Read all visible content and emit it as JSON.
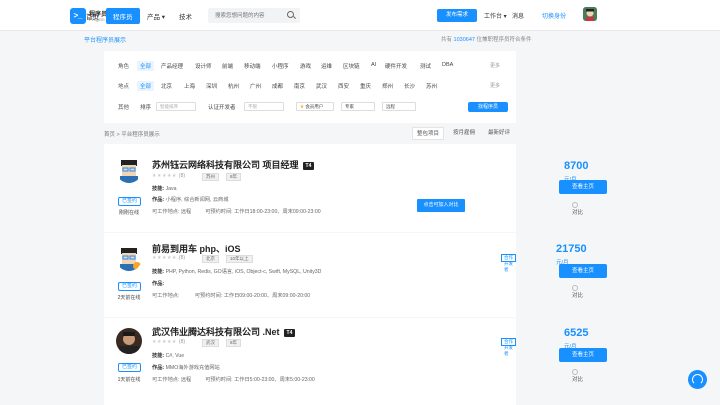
{
  "logo": {
    "name": "程序员客栈",
    "domain": "Proginn.com"
  },
  "nav": [
    "首页",
    "程序员",
    "产品",
    "技术"
  ],
  "search_placeholder": "搜索您想问题的内容",
  "header_right": {
    "post": "发布需求",
    "workspace": "工作台",
    "messages": "消息",
    "switch": "切换身份"
  },
  "sub": {
    "title": "平台程序员展示",
    "stats_prefix": "共有",
    "stats_count": "1030647",
    "stats_suffix": "位兼职程序员符合条件"
  },
  "filters": {
    "role_label": "角色",
    "roles": [
      "全部",
      "产品经理",
      "设计师",
      "前端",
      "移动端",
      "小程序",
      "游戏",
      "运维",
      "区块链",
      "AI",
      "硬件开发",
      "测试",
      "DBA"
    ],
    "location_label": "地点",
    "locations": [
      "全部",
      "北京",
      "上海",
      "深圳",
      "杭州",
      "广州",
      "成都",
      "南京",
      "武汉",
      "西安",
      "重庆",
      "郑州",
      "长沙",
      "苏州"
    ],
    "more": "更多",
    "other_label": "其他",
    "sort_label": "排序",
    "sort_value": "智能排序",
    "cert_label": "认证开发者",
    "cert_value": "不限",
    "vip_label": "会员用户",
    "expert_label": "专家",
    "remote_label": "远程",
    "submit": "找程序员"
  },
  "breadcrumb": "首页 > 平台程序员展示",
  "sort_tabs": [
    "整包项目",
    "按月雇佣",
    "最新好评"
  ],
  "tooltip": "点击可加入对比",
  "cards": [
    {
      "name": "苏州钰云网络科技有限公司 项目经理",
      "level": "T4",
      "badge": "已签约",
      "status": "刚刚在线",
      "rating": "★★★★★",
      "count": "(8)",
      "tags": [
        "苏州",
        "8年"
      ],
      "skills_label": "技能:",
      "skills": "Java",
      "works_label": "作品:",
      "works": "小程序, 综合新闻网, 云商城",
      "avail_label": "可工作地点:",
      "avail": "远程",
      "time_label": "可预约时间:",
      "time": "工作日18:00-23:00、周末09:00-23:00",
      "price": "8700",
      "unit": "元/月",
      "home": "查看主页",
      "compare": "对比"
    },
    {
      "name": "前易到用车 php、iOS",
      "level": "",
      "badge": "已签约",
      "status": "2天前在线",
      "rating": "★★★★★",
      "count": "(8)",
      "tags": [
        "北京",
        "10年以上"
      ],
      "skills_label": "技能:",
      "skills": "PHP, Python, Redis, GO语言, iOS, Object-c, Swift, MySQL, Unity3D",
      "works_label": "作品:",
      "works": "",
      "avail_label": "可工作地点:",
      "avail": "",
      "time_label": "可预约时间:",
      "time": "工作日09:00-20:00、周末09:00-20:00",
      "price": "21750",
      "unit": "元/月",
      "home": "查看主页",
      "compare": "对比",
      "cert": "合作开发者"
    },
    {
      "name": "武汉伟业腾达科技有限公司 .Net",
      "level": "T4",
      "badge": "已签约",
      "status": "1天前在线",
      "rating": "★★★★★",
      "count": "(8)",
      "tags": [
        "武汉",
        "8年"
      ],
      "skills_label": "技能:",
      "skills": "C#, Vue",
      "works_label": "作品:",
      "works": "MMO海外游戏充值网站",
      "avail_label": "可工作地点:",
      "avail": "远程",
      "time_label": "可预约时间:",
      "time": "工作日5:00-23:00、周末5:00-23:00",
      "price": "6525",
      "unit": "元/月",
      "home": "查看主页",
      "compare": "对比",
      "cert": "合作开发者"
    }
  ],
  "colors": {
    "brand": "#1890ff",
    "background": "#f5f6f8"
  },
  "icons": {
    "search": "search-icon",
    "support": "headset-icon"
  }
}
